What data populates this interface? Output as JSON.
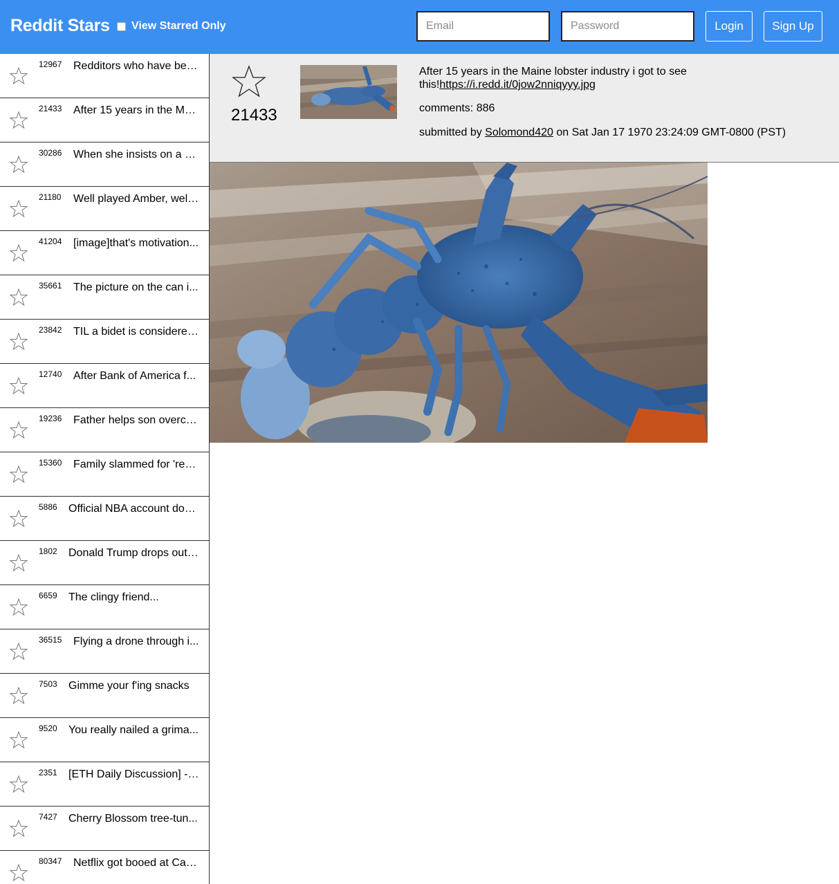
{
  "header": {
    "brand": "Reddit Stars",
    "starred_toggle_label": "View Starred Only",
    "email_placeholder": "Email",
    "password_placeholder": "Password",
    "login_label": "Login",
    "signup_label": "Sign Up",
    "bg_color": "#3b8ff0"
  },
  "sidebar": {
    "items": [
      {
        "score": "12967",
        "title": "Redditors who have bee..."
      },
      {
        "score": "21433",
        "title": "After 15 years in the Ma..."
      },
      {
        "score": "30286",
        "title": "When she insists on a s..."
      },
      {
        "score": "21180",
        "title": "Well played Amber, well ..."
      },
      {
        "score": "41204",
        "title": "[image]that's motivation..."
      },
      {
        "score": "35661",
        "title": "The picture on the can i..."
      },
      {
        "score": "23842",
        "title": "TIL a bidet is considered..."
      },
      {
        "score": "12740",
        "title": "After Bank of America f..."
      },
      {
        "score": "19236",
        "title": "Father helps son overco..."
      },
      {
        "score": "15360",
        "title": "Family slammed for 'rec..."
      },
      {
        "score": "5886",
        "title": "Official NBA account doe..."
      },
      {
        "score": "1802",
        "title": "Donald Trump drops out ..."
      },
      {
        "score": "6659",
        "title": "The clingy friend..."
      },
      {
        "score": "36515",
        "title": "Flying a drone through i..."
      },
      {
        "score": "7503",
        "title": "Gimme your f'ing snacks"
      },
      {
        "score": "9520",
        "title": "You really nailed a grima..."
      },
      {
        "score": "2351",
        "title": "[ETH Daily Discussion] - ..."
      },
      {
        "score": "7427",
        "title": "Cherry Blossom tree-tun..."
      },
      {
        "score": "80347",
        "title": "Netflix got booed at Can..."
      }
    ]
  },
  "detail": {
    "score": "21433",
    "title_text": "After 15 years in the Maine lobster industry i got to see this!",
    "link": "https://i.redd.it/0jow2nniqyyy.jpg",
    "comments": "comments: 886",
    "submitted_prefix": "submitted by ",
    "author": "Solomond420",
    "submitted_suffix": " on Sat Jan 17 1970 23:24:09 GMT-0800 (PST)"
  },
  "icons": {
    "star": "star-outline-icon",
    "image": "blue-lobster-photo"
  }
}
